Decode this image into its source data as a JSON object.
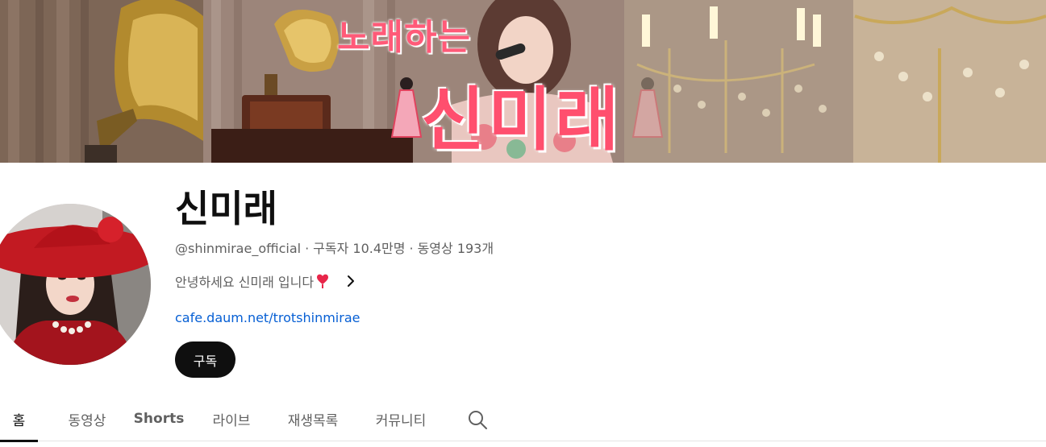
{
  "banner": {
    "title_top": "노래하는",
    "title_main": "신미래"
  },
  "channel": {
    "name": "신미래",
    "handle": "@shinmirae_official",
    "separator": "·",
    "subscribers": "구독자 10.4만명",
    "videos": "동영상 193개",
    "description": "안녕하세요 신미래 입니다",
    "link": "cafe.daum.net/trotshinmirae",
    "subscribe_label": "구독"
  },
  "tabs": [
    {
      "label": "홈",
      "active": true
    },
    {
      "label": "동영상",
      "active": false
    },
    {
      "label": "Shorts",
      "active": false
    },
    {
      "label": "라이브",
      "active": false
    },
    {
      "label": "재생목록",
      "active": false
    },
    {
      "label": "커뮤니티",
      "active": false
    }
  ],
  "icons": {
    "description_heart": "heart-icon",
    "description_more": "chevron-right-icon",
    "tab_search": "search-icon"
  },
  "colors": {
    "link": "#065fd4",
    "subscribe_bg": "#0f0f0f",
    "banner_title": "#ff4f6e"
  }
}
